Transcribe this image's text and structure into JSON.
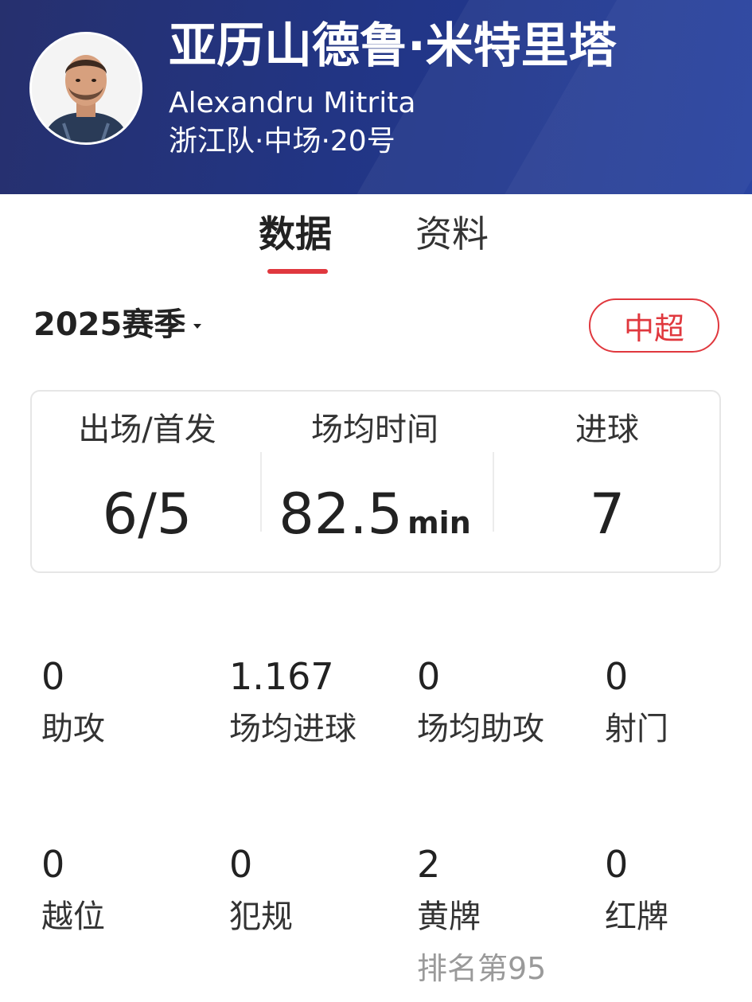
{
  "player": {
    "name_cn": "亚历山德鲁·米特里塔",
    "name_en": "Alexandru Mitrita",
    "meta": "浙江队·中场·20号"
  },
  "tabs": [
    {
      "label": "数据",
      "active": true
    },
    {
      "label": "资料",
      "active": false
    }
  ],
  "season": {
    "label": "2025赛季"
  },
  "league": {
    "label": "中超"
  },
  "summary": [
    {
      "label": "出场/首发",
      "value": "6/5",
      "unit": ""
    },
    {
      "label": "场均时间",
      "value": "82.5",
      "unit": "min"
    },
    {
      "label": "进球",
      "value": "7",
      "unit": ""
    }
  ],
  "stats": [
    {
      "value": "0",
      "label": "助攻"
    },
    {
      "value": "1.167",
      "label": "场均进球"
    },
    {
      "value": "0",
      "label": "场均助攻"
    },
    {
      "value": "0",
      "label": "射门"
    },
    {
      "value": "0",
      "label": "越位"
    },
    {
      "value": "0",
      "label": "犯规"
    },
    {
      "value": "2",
      "label": "黄牌",
      "rank": "排名第95"
    },
    {
      "value": "0",
      "label": "红牌"
    }
  ],
  "colors": {
    "accent": "#e0383e",
    "header": "#223584"
  }
}
